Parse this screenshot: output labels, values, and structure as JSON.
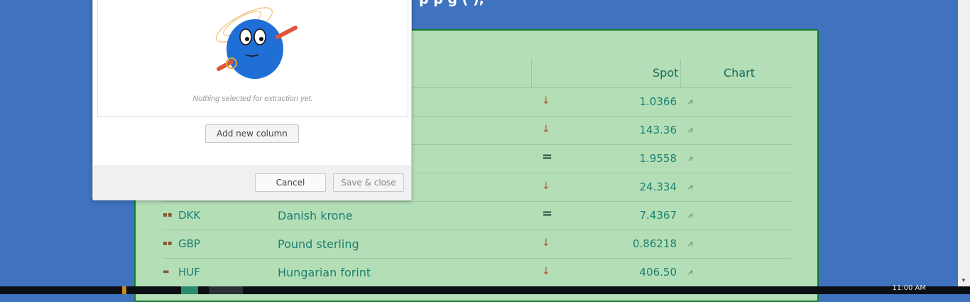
{
  "page": {
    "heading_fragment": "p p g (  ),",
    "background_color": "#3f73bf"
  },
  "table": {
    "headers": {
      "spot": "Spot",
      "chart": "Chart"
    },
    "rows": [
      {
        "flag": "",
        "code": "",
        "name": "",
        "trend": "↓",
        "trend_type": "down",
        "spot": "1.0366",
        "chart_icon": "⩘"
      },
      {
        "flag": "",
        "code": "",
        "name": "",
        "trend": "↓",
        "trend_type": "down",
        "spot": "143.36",
        "chart_icon": "⩘"
      },
      {
        "flag": "",
        "code": "",
        "name": "",
        "trend": "=",
        "trend_type": "eq",
        "spot": "1.9558",
        "chart_icon": "⩘"
      },
      {
        "flag": "",
        "code": "",
        "name": "",
        "trend": "↓",
        "trend_type": "down",
        "spot": "24.334",
        "chart_icon": "⩘"
      },
      {
        "flag": "▪▪",
        "code": "DKK",
        "name": "Danish krone",
        "trend": "=",
        "trend_type": "eq",
        "spot": "7.4367",
        "chart_icon": "⩘"
      },
      {
        "flag": "▪▪",
        "code": "GBP",
        "name": "Pound sterling",
        "trend": "↓",
        "trend_type": "down",
        "spot": "0.86218",
        "chart_icon": "⩘"
      },
      {
        "flag": "▬",
        "code": "HUF",
        "name": "Hungarian forint",
        "trend": "↓",
        "trend_type": "down",
        "spot": "406.50",
        "chart_icon": "⩘"
      }
    ],
    "colors": {
      "background": "#b4dfb6",
      "border": "#127a2e",
      "text": "#1d7f73",
      "down": "#b4512b"
    }
  },
  "dialog": {
    "empty_message": "Nothing selected for extraction yet.",
    "add_column_label": "Add new column",
    "cancel_label": "Cancel",
    "save_label": "Save & close",
    "mascot_icon": "robot-mascot-icon"
  },
  "taskbar": {
    "time": "11:00 AM"
  }
}
